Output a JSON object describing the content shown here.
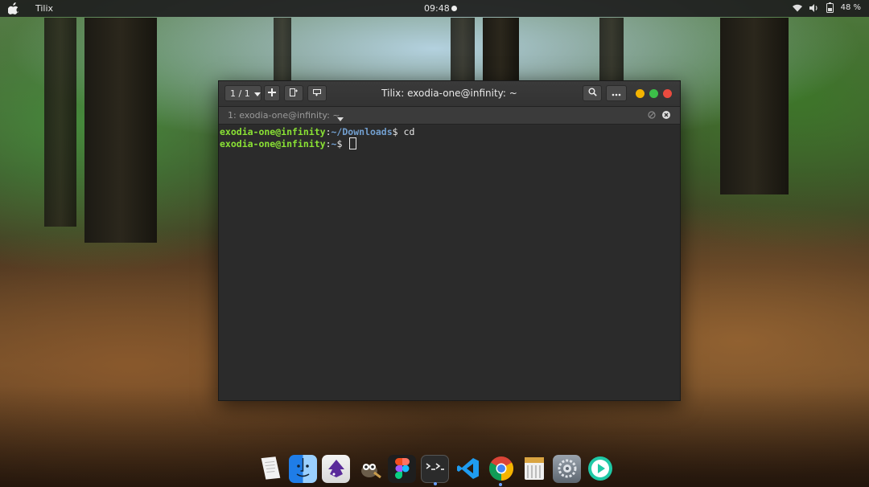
{
  "topbar": {
    "app_name": "Tilix",
    "clock": "09:48",
    "battery": "48 %",
    "icons": [
      "apple-icon",
      "wifi-icon",
      "volume-icon",
      "battery-icon"
    ]
  },
  "window": {
    "title": "Tilix: exodia-one@infinity: ~",
    "session_selector": "1 / 1",
    "tab_label": "1: exodia-one@infinity: ~",
    "controls": {
      "minimize": "#f4b400",
      "maximize": "#3cbf49",
      "close": "#ea4b3f"
    }
  },
  "terminal": {
    "lines": [
      {
        "user": "exodia-one@infinity",
        "sep": ":",
        "path": "~/Downloads",
        "prompt": "$ ",
        "cmd": "cd"
      },
      {
        "user": "exodia-one@infinity",
        "sep": ":",
        "path": "~",
        "prompt": "$ ",
        "cmd": ""
      }
    ]
  },
  "dock": {
    "items": [
      {
        "name": "text-editor-icon"
      },
      {
        "name": "finder-icon"
      },
      {
        "name": "inkscape-icon"
      },
      {
        "name": "gimp-icon"
      },
      {
        "name": "figma-icon"
      },
      {
        "name": "terminal-icon"
      },
      {
        "name": "vscode-icon"
      },
      {
        "name": "chrome-icon"
      },
      {
        "name": "archive-icon"
      },
      {
        "name": "settings-icon"
      },
      {
        "name": "media-player-icon"
      }
    ]
  },
  "colors": {
    "prompt_user": "#8ae234",
    "prompt_path": "#729fcf",
    "terminal_bg": "#2b2b2b"
  }
}
